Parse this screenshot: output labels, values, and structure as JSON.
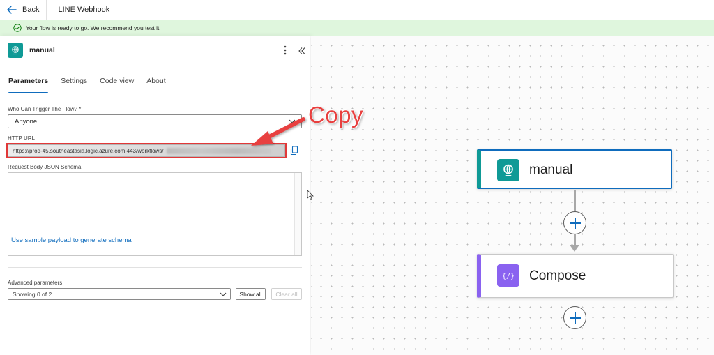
{
  "topbar": {
    "back_label": "Back",
    "flow_title": "LINE Webhook"
  },
  "notification": {
    "text": "Your flow is ready to go. We recommend you test it."
  },
  "panel": {
    "title": "manual",
    "tabs": [
      "Parameters",
      "Settings",
      "Code view",
      "About"
    ],
    "active_tab": "Parameters",
    "who_label": "Who Can Trigger The Flow? *",
    "who_value": "Anyone",
    "http_url_label": "HTTP URL",
    "http_url_value": "https://prod-45.southeastasia.logic.azure.com:443/workflows/",
    "schema_label": "Request Body JSON Schema",
    "sample_link": "Use sample payload to generate schema",
    "advanced_label": "Advanced parameters",
    "advanced_value": "Showing 0 of 2",
    "show_all": "Show all",
    "clear_all": "Clear all"
  },
  "canvas": {
    "nodes": [
      {
        "title": "manual",
        "icon": "http-trigger-icon",
        "accent": "#0f9a96"
      },
      {
        "title": "Compose",
        "icon": "compose-icon",
        "accent": "#8a62f0"
      }
    ]
  },
  "annotation": {
    "label": "Copy",
    "color": "#e8403f"
  },
  "colors": {
    "accent": "#0f6cbd",
    "success_bg": "#dff6dd",
    "trigger": "#0f9a96",
    "compose": "#8a62f0"
  }
}
